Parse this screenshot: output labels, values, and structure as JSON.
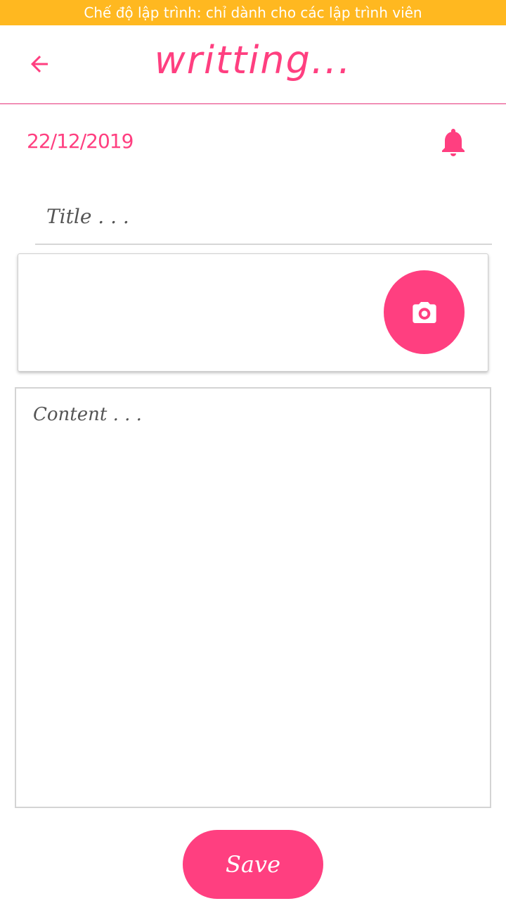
{
  "status_banner": {
    "text": "Chế độ lập trình: chỉ dành cho các lập trình viên"
  },
  "appbar": {
    "title": "writting...",
    "back_icon": "arrow-left-icon"
  },
  "note": {
    "date": "22/12/2019",
    "reminder_icon": "bell-icon",
    "title_placeholder": "Title . . .",
    "content_placeholder": "Content . . ."
  },
  "image_card": {
    "camera_icon": "camera-icon"
  },
  "actions": {
    "save_label": "Save"
  },
  "colors": {
    "accent": "#ff3f80",
    "banner": "#ffb820",
    "divider": "#d6d6d6"
  }
}
